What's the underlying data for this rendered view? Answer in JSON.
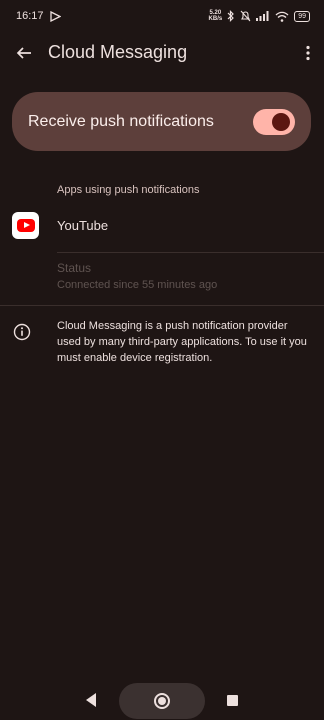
{
  "status_bar": {
    "time": "16:17",
    "net_speed_value": "5.20",
    "net_speed_unit": "KB/s",
    "battery": "99"
  },
  "app_bar": {
    "title": "Cloud Messaging"
  },
  "master_switch": {
    "label": "Receive push notifications",
    "enabled": true
  },
  "apps_section": {
    "header": "Apps using push notifications",
    "apps": [
      {
        "name": "YouTube",
        "icon": "youtube-icon"
      }
    ]
  },
  "status": {
    "title": "Status",
    "detail": "Connected since 55 minutes ago"
  },
  "info": {
    "icon": "info-icon",
    "text": "Cloud Messaging is a push notification provider used by many third-party applications. To use it you must enable device registration."
  },
  "colors": {
    "background": "#1e1514",
    "card": "#5d3f3b",
    "toggle_track": "#ffb4a9",
    "toggle_thumb": "#5c1711"
  }
}
